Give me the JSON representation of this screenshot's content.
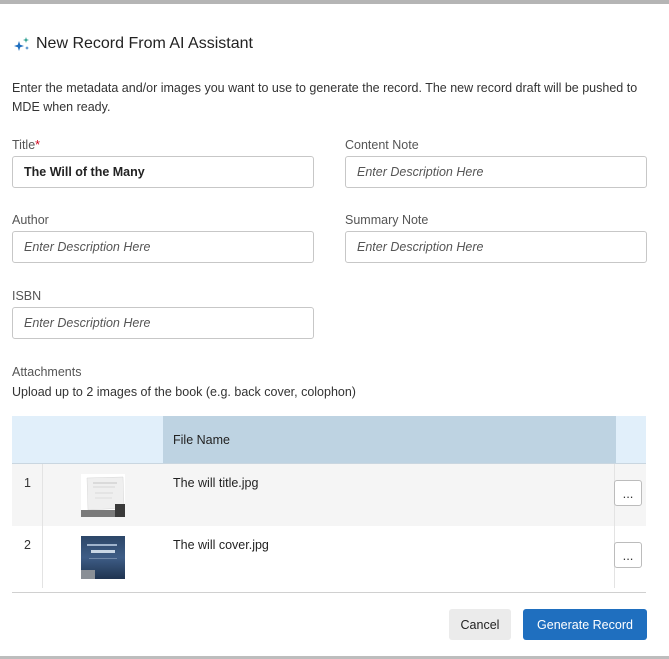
{
  "dialog": {
    "title": "New Record From AI Assistant",
    "intro": "Enter the metadata and/or images you want to use to generate the record. The new record draft will be pushed to MDE when ready."
  },
  "form": {
    "title": {
      "label": "Title",
      "required_mark": "*",
      "value": "The Will of the Many"
    },
    "content_note": {
      "label": "Content Note",
      "placeholder": "Enter Description Here"
    },
    "author": {
      "label": "Author",
      "placeholder": "Enter Description Here"
    },
    "summary_note": {
      "label": "Summary Note",
      "placeholder": "Enter Description Here"
    },
    "isbn": {
      "label": "ISBN",
      "placeholder": "Enter Description Here"
    }
  },
  "attachments": {
    "label": "Attachments",
    "help": "Upload up to 2 images of the book (e.g. back cover, colophon)",
    "column_header": "File Name",
    "rows": [
      {
        "index": "1",
        "file_name": "The will title.jpg",
        "more": "..."
      },
      {
        "index": "2",
        "file_name": "The will cover.jpg",
        "more": "..."
      }
    ]
  },
  "actions": {
    "cancel": "Cancel",
    "generate": "Generate Record"
  },
  "colors": {
    "primary": "#1f6fbf",
    "required": "#d0021b",
    "header_bg": "#e1effa",
    "header_active_bg": "#bed3e2"
  }
}
